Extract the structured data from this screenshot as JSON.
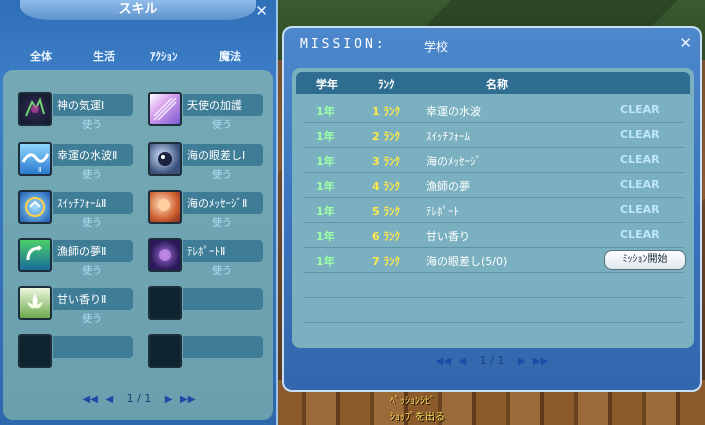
{
  "skill_window": {
    "title": "スキル",
    "close_glyph": "✕",
    "tabs": [
      "全体",
      "生活",
      "ｱｸｼｮﾝ",
      "魔法"
    ],
    "slots": [
      {
        "name": "神の気運Ⅰ",
        "use": "使う",
        "icon": "fortune-icon"
      },
      {
        "name": "天使の加護",
        "use": "使う",
        "icon": "angel-icon"
      },
      {
        "name": "幸運の水波Ⅱ",
        "use": "使う",
        "icon": "water-wave-icon"
      },
      {
        "name": "海の眼差しⅠ",
        "use": "使う",
        "icon": "sea-gaze-icon"
      },
      {
        "name": "ｽｲｯﾁﾌｫｰﾑⅡ",
        "use": "使う",
        "icon": "switch-form-icon"
      },
      {
        "name": "海のﾒｯｾｰｼﾞⅡ",
        "use": "使う",
        "icon": "sea-message-icon"
      },
      {
        "name": "漁師の夢Ⅱ",
        "use": "使う",
        "icon": "fisher-dream-icon"
      },
      {
        "name": "ﾃﾚﾎﾟｰﾄⅡ",
        "use": "使う",
        "icon": "teleport-icon"
      },
      {
        "name": "甘い香りⅡ",
        "use": "使う",
        "icon": "sweet-scent-icon"
      }
    ],
    "pager": {
      "first": "◀◀",
      "prev": "◀",
      "current": "1 / 1",
      "next": "▶",
      "last": "▶▶"
    }
  },
  "mission_window": {
    "title": "MISSION:",
    "subtitle": "学校",
    "close_glyph": "✕",
    "headers": {
      "grade": "学年",
      "rank": "ﾗﾝｸ",
      "name": "名称"
    },
    "rows": [
      {
        "grade": "1年",
        "rank": "1 ﾗﾝｸ",
        "name": "幸運の水波",
        "status": "CLEAR"
      },
      {
        "grade": "1年",
        "rank": "2 ﾗﾝｸ",
        "name": "ｽｲｯﾁﾌｫｰﾑ",
        "status": "CLEAR"
      },
      {
        "grade": "1年",
        "rank": "3 ﾗﾝｸ",
        "name": "海のﾒｯｾｰｼﾞ",
        "status": "CLEAR"
      },
      {
        "grade": "1年",
        "rank": "4 ﾗﾝｸ",
        "name": "漁師の夢",
        "status": "CLEAR"
      },
      {
        "grade": "1年",
        "rank": "5 ﾗﾝｸ",
        "name": "ﾃﾚﾎﾟｰﾄ",
        "status": "CLEAR"
      },
      {
        "grade": "1年",
        "rank": "6 ﾗﾝｸ",
        "name": "甘い香り",
        "status": "CLEAR"
      },
      {
        "grade": "1年",
        "rank": "7 ﾗﾝｸ",
        "name": "海の眼差し(5/0)",
        "button": "ﾐｯｼｮﾝ開始"
      }
    ],
    "pager": {
      "first": "◀◀",
      "prev": "◀",
      "current": "1 / 1",
      "next": "▶",
      "last": "▶▶"
    }
  },
  "background_text": {
    "line1": "ﾍﾟｯｼｮﾝｼﾋﾞ",
    "line2": "ｼｮｯﾌﾟを出る"
  }
}
